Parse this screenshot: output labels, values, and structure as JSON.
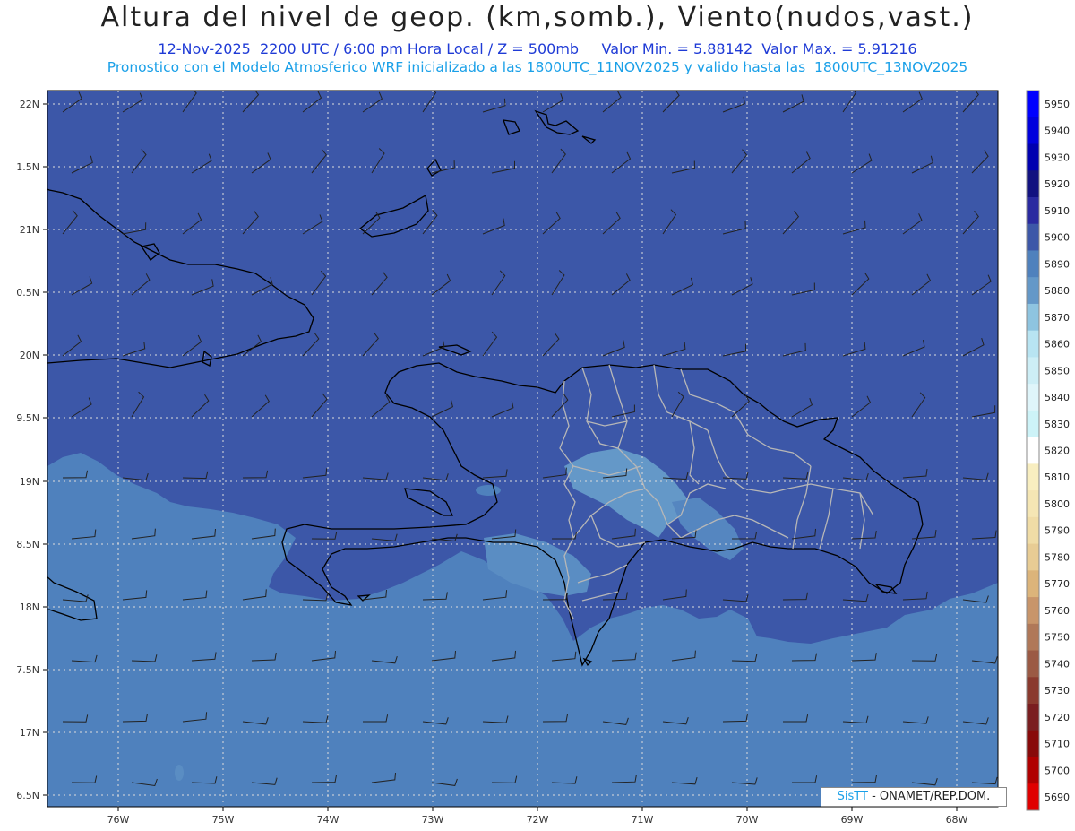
{
  "header": {
    "title": "Altura del nivel de geop. (km,somb.), Viento(nudos,vast.)",
    "subtitle_left": "12-Nov-2025  2200 UTC / 6:00 pm Hora Local / Z = 500mb",
    "subtitle_right": "Valor Min. = 5.88142  Valor Max. = 5.91216",
    "subtitle2": "Pronostico con el Modelo Atmosferico WRF inicializado a las 1800UTC_11NOV2025 y valido hasta las  1800UTC_13NOV2025"
  },
  "map": {
    "lat_labels": [
      "22N",
      "1.5N",
      "21N",
      "0.5N",
      "20N",
      "9.5N",
      "19N",
      "8.5N",
      "18N",
      "7.5N",
      "17N",
      "6.5N"
    ],
    "lon_labels": [
      "76W",
      "75W",
      "74W",
      "73W",
      "72W",
      "71W",
      "70W",
      "69W",
      "68W"
    ],
    "fill_colors": {
      "level_5900": "#3c57a8",
      "level_5890": "#4f81bd",
      "level_5880": "#6498c8"
    },
    "coast_color": "#000000",
    "border_color": "#b7b7b7"
  },
  "colorbar": {
    "levels": [
      "5950",
      "5940",
      "5930",
      "5920",
      "5910",
      "5900",
      "5890",
      "5880",
      "5870",
      "5860",
      "5850",
      "5840",
      "5830",
      "5820",
      "5810",
      "5800",
      "5790",
      "5780",
      "5770",
      "5760",
      "5750",
      "5740",
      "5730",
      "5720",
      "5710",
      "5700",
      "5690"
    ],
    "colors": [
      "#0000ff",
      "#0000dd",
      "#0000b0",
      "#121280",
      "#2a2aa0",
      "#3c57a8",
      "#4f81bd",
      "#6498c8",
      "#8ec4e0",
      "#b8e4f2",
      "#cdeef6",
      "#dff5fa",
      "#cdf3f8",
      "#ffffff",
      "#f8eec0",
      "#f5e6b4",
      "#f0dca6",
      "#e8cc94",
      "#dcb47a",
      "#c8956a",
      "#b07858",
      "#9b5a44",
      "#8a3a2e",
      "#7a1e20",
      "#880a0a",
      "#b00000",
      "#e00000"
    ]
  },
  "credit": {
    "brand": "SisTT",
    "text": " - ONAMET/REP.DOM."
  }
}
